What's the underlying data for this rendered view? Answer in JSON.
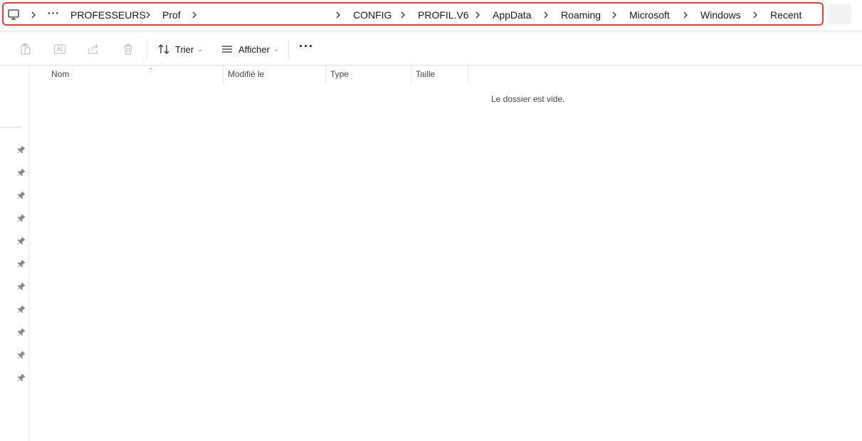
{
  "address": {
    "crumbs": [
      "PROFESSEURS",
      "Prof",
      "CONFIG",
      "PROFIL.V6",
      "AppData",
      "Roaming",
      "Microsoft",
      "Windows",
      "Recent"
    ],
    "overflow": "···"
  },
  "toolbar": {
    "sort_label": "Trier",
    "view_label": "Afficher",
    "more": "···"
  },
  "columns": [
    "Nom",
    "Modifié le",
    "Type",
    "Taille"
  ],
  "content": {
    "empty_message": "Le dossier est vide."
  },
  "colors": {
    "highlight": "#e0413a",
    "text": "#1a1a1a",
    "muted": "#4a4a4a"
  }
}
